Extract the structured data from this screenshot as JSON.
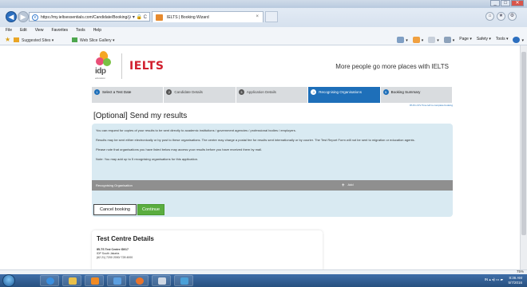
{
  "browser": {
    "url": "https://my.ieltsessentials.com/Candidate/Booking/",
    "address_controls": "ρ ▾ 🔒 C",
    "tab_title": "IELTS | Booking Wizard",
    "menu": [
      "File",
      "Edit",
      "View",
      "Favorites",
      "Tools",
      "Help"
    ],
    "favorites": [
      "Suggested Sites ▾",
      "Web Slice Gallery ▾"
    ],
    "command_bar": [
      "Page ▾",
      "Safety ▾",
      "Tools ▾"
    ],
    "zoom": "75%"
  },
  "site": {
    "logo_text": "idp",
    "logo_sub": "education",
    "brand": "IELTS",
    "tagline": "More people go more places with IELTS"
  },
  "steps": [
    {
      "num": "1",
      "label": "Select a Test Date",
      "state": "done"
    },
    {
      "num": "2",
      "label": "Candidate Details",
      "state": "todo"
    },
    {
      "num": "3",
      "label": "Application Details",
      "state": "todo"
    },
    {
      "num": "4",
      "label": "Recognising Organisations",
      "state": "active"
    },
    {
      "num": "5",
      "label": "Booking Summary",
      "state": "done"
    }
  ],
  "time_left": "8h 8m 37s Time left to complete booking",
  "page": {
    "title": "[Optional] Send my results",
    "info": [
      "You can request for copies of your results to be sent directly to academic institutions / government agencies / professional bodies / employers.",
      "Results may be sent either electronically or by post to these organisations. The centre may charge a postal fee for results sent internationally or by courier. The Test Report Form will not be sent to migration or education agents.",
      "Please note that organisations you have listed below may access your results before you have received them by mail.",
      "Note: You may add up to 5 recognising organisations for this application."
    ],
    "table_header": "Recognising Organisation",
    "add_icon": "+",
    "add_label": "Add",
    "cancel_label": "Cancel booking",
    "continue_label": "Continue"
  },
  "centre": {
    "heading": "Test Centre Details",
    "name": "IELTS Test Centre ID017",
    "location": "IDP South Jakarta",
    "phone": "(62 21) 7200 2000/ 728 4000"
  },
  "taskbar": {
    "tray": "IN  ▴  ◂)  ▭  ▰",
    "time": "8:36 AM",
    "date": "5/7/2016"
  },
  "colors": {
    "ielts_red": "#d11f2e",
    "step_blue": "#1e6fb9",
    "info_bg": "#d9eaf2",
    "continue_green": "#5aad3f"
  }
}
